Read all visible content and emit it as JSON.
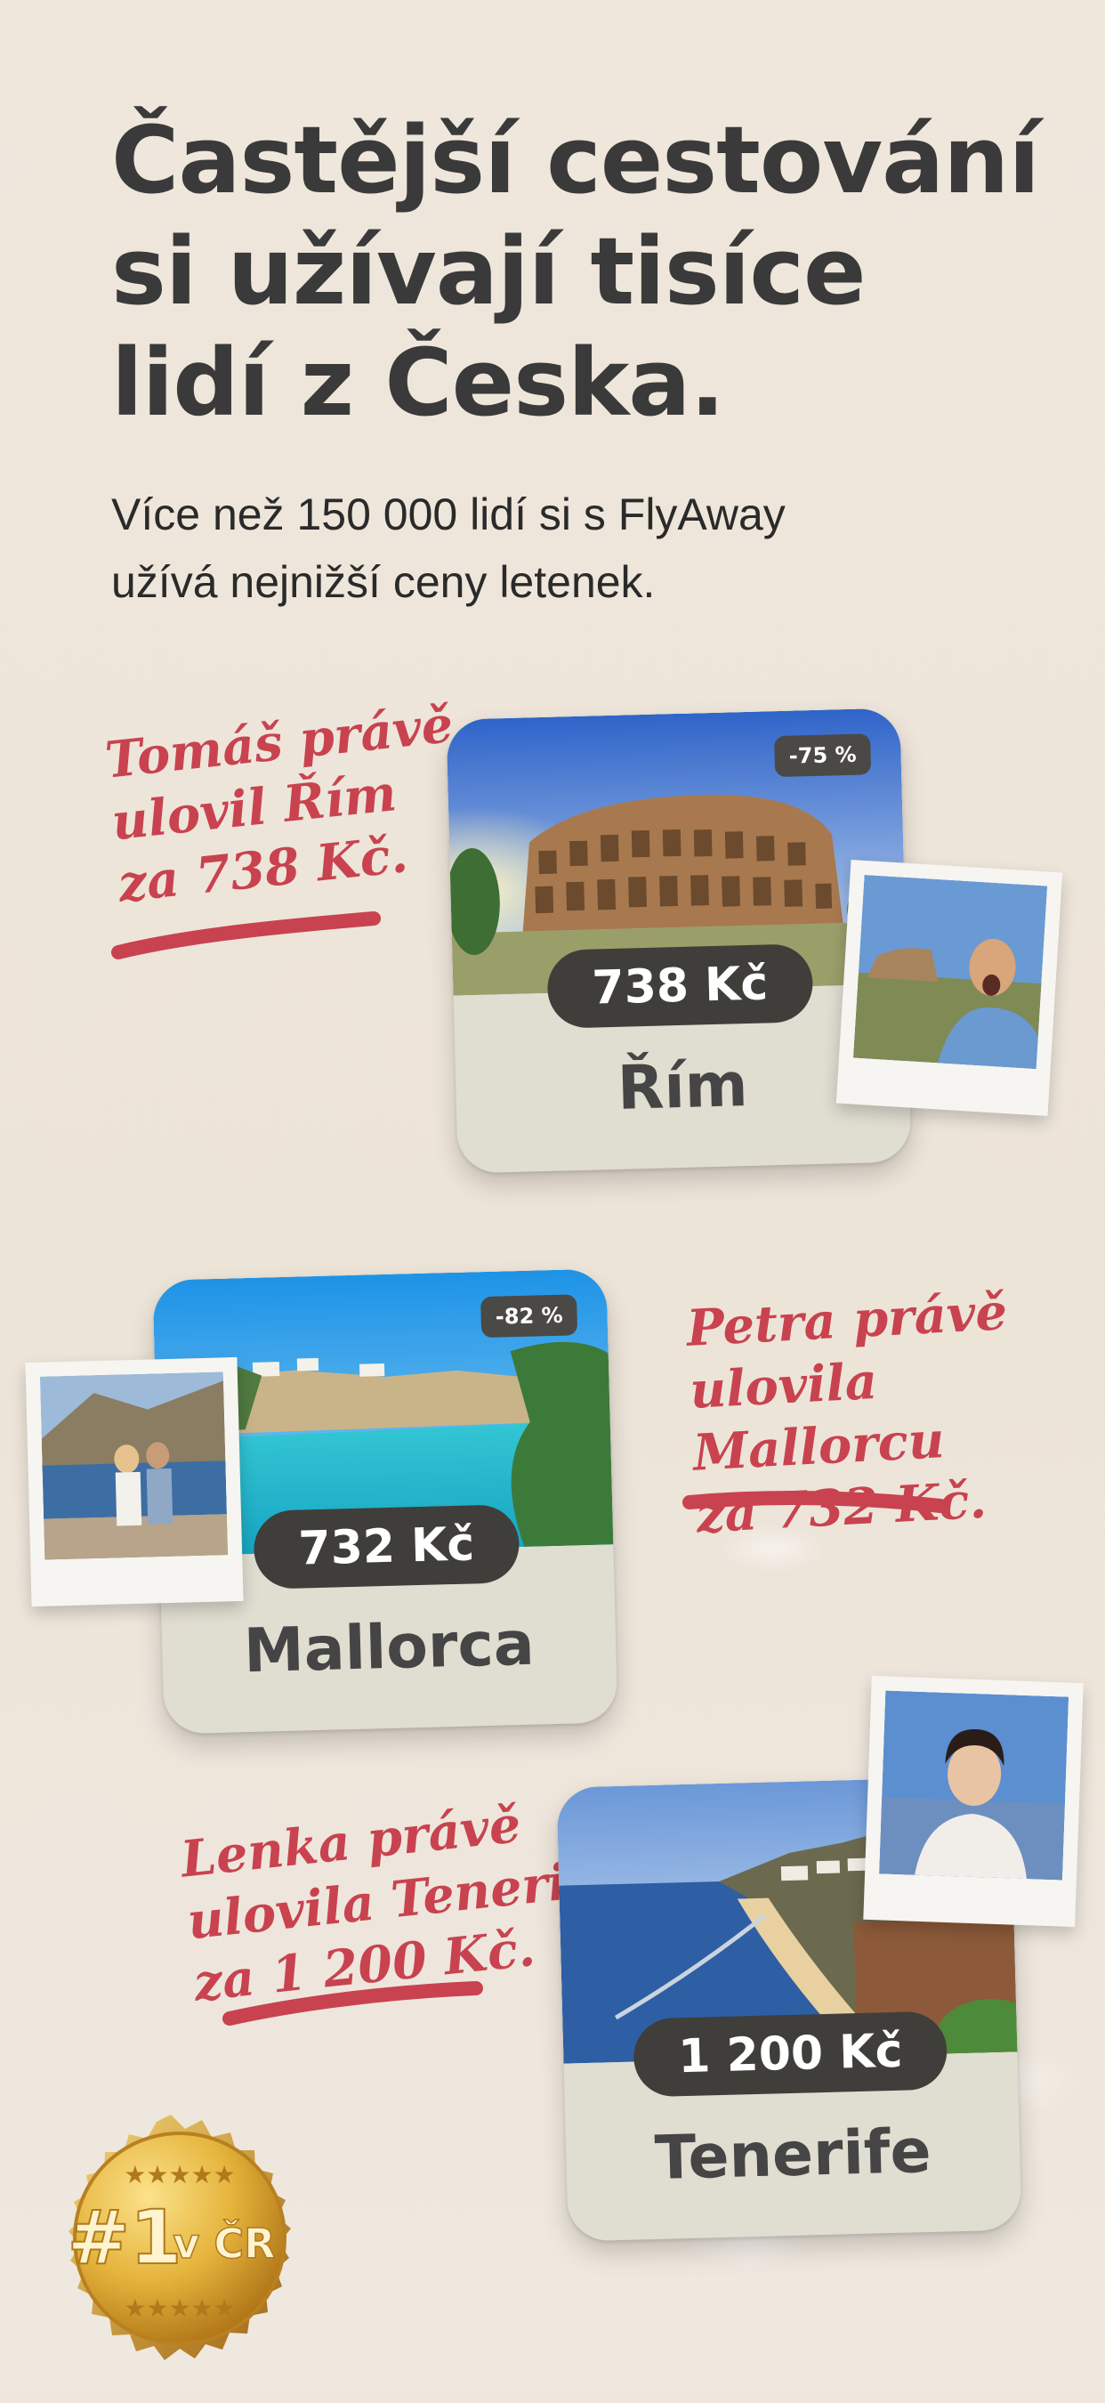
{
  "headline": {
    "lines": [
      "Častější cestování",
      "si užívají tisíce",
      "lidí z Česka."
    ]
  },
  "subline": {
    "lines": [
      "Více než 150 000 lidí si s FlyAway",
      "užívá nejnižší ceny letenek."
    ]
  },
  "deals": [
    {
      "catch_lines": [
        "Tomáš právě",
        "ulovil Řím",
        "za 738 Kč."
      ],
      "discount": "-75 %",
      "price": "738 Kč",
      "city": "Řím"
    },
    {
      "catch_lines": [
        "Petra právě",
        "ulovila Mallorcu",
        "za 732 Kč."
      ],
      "discount": "-82 %",
      "price": "732 Kč",
      "city": "Mallorca"
    },
    {
      "catch_lines": [
        "Lenka právě",
        "ulovila Tenerife",
        "za 1 200 Kč."
      ],
      "discount": "",
      "price": "1 200 Kč",
      "city": "Tenerife"
    }
  ],
  "badge": {
    "rank": "#1",
    "suffix": "v ČR",
    "stars_top": "★★★★★",
    "stars_bottom": "★★★★★"
  },
  "colors": {
    "accent_red": "#c8434f",
    "price_pill": "#3f3e3b",
    "card": "#e0ddd1",
    "gold": "#e5b43c"
  }
}
